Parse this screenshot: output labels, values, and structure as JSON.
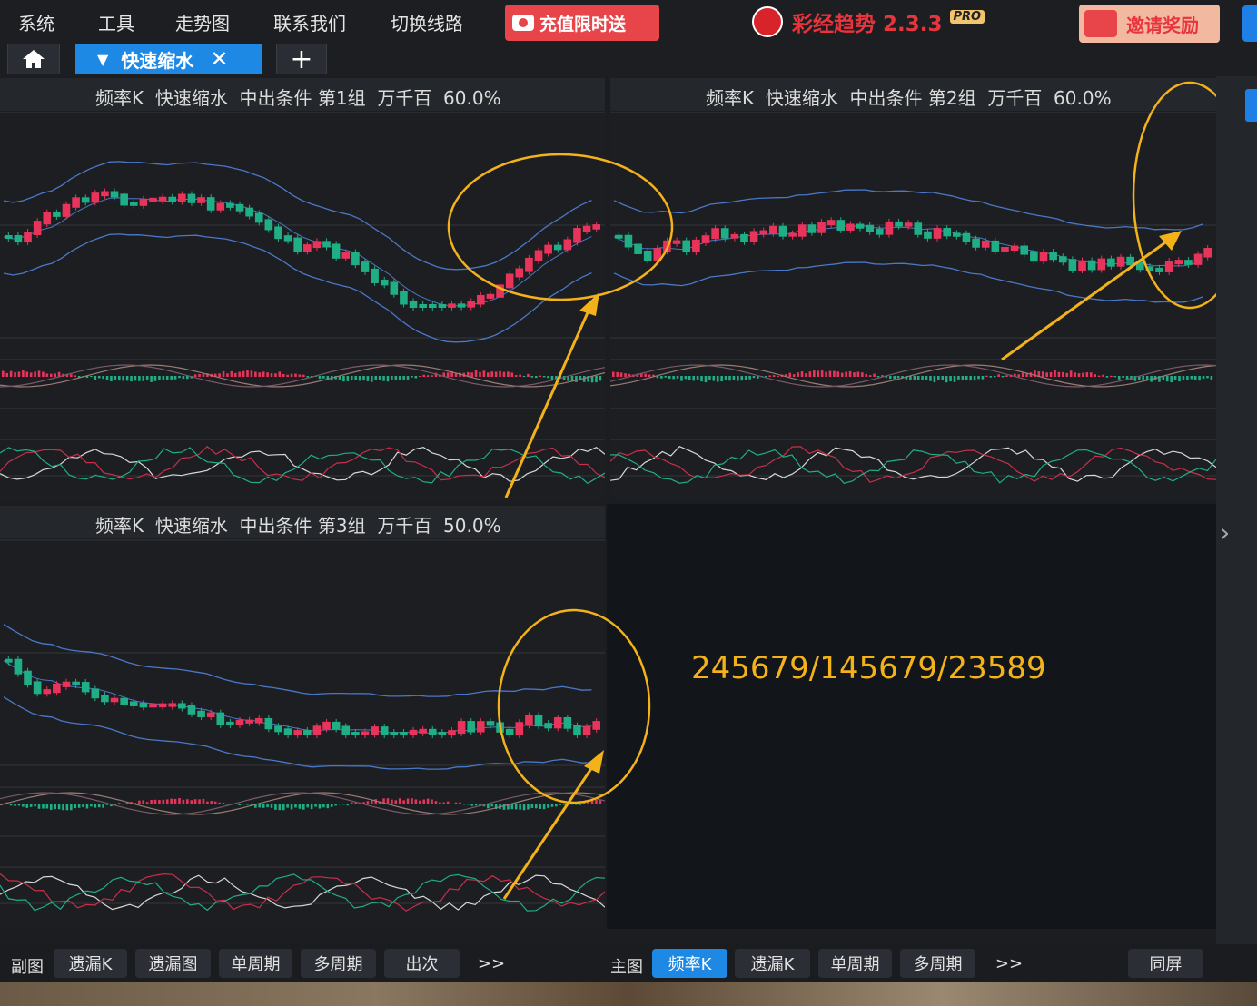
{
  "menu": {
    "items": [
      "系统",
      "工具",
      "走势图",
      "联系我们",
      "切换线路"
    ],
    "promo_label": "充值限时送",
    "brand_name": "彩经趋势 2.3.3",
    "brand_badge": "PRO",
    "invite_label": "邀请奖励"
  },
  "tabs": {
    "active_label": "快速缩水",
    "close_glyph": "✕",
    "add_glyph": "+"
  },
  "panes": [
    {
      "title": "频率K  快速缩水  中出条件 第1组  万千百  60.0%"
    },
    {
      "title": "频率K  快速缩水  中出条件 第2组  万千百  60.0%"
    },
    {
      "title": "频率K  快速缩水  中出条件 第3组  万千百  50.0%"
    }
  ],
  "annotation": {
    "text": "245679/145679/23589",
    "color": "#f4b21a"
  },
  "colors": {
    "up": "#e8345a",
    "down": "#1fae86",
    "band": "#4a78c8",
    "accent": "#1e88e5"
  },
  "bottombar": {
    "sub_label": "副图",
    "sub_buttons": [
      "遗漏K",
      "遗漏图",
      "单周期",
      "多周期",
      "出次",
      ">>"
    ],
    "main_label": "主图",
    "main_buttons": [
      "频率K",
      "遗漏K",
      "单周期",
      "多周期",
      ">>"
    ],
    "same_screen": "同屏"
  }
}
